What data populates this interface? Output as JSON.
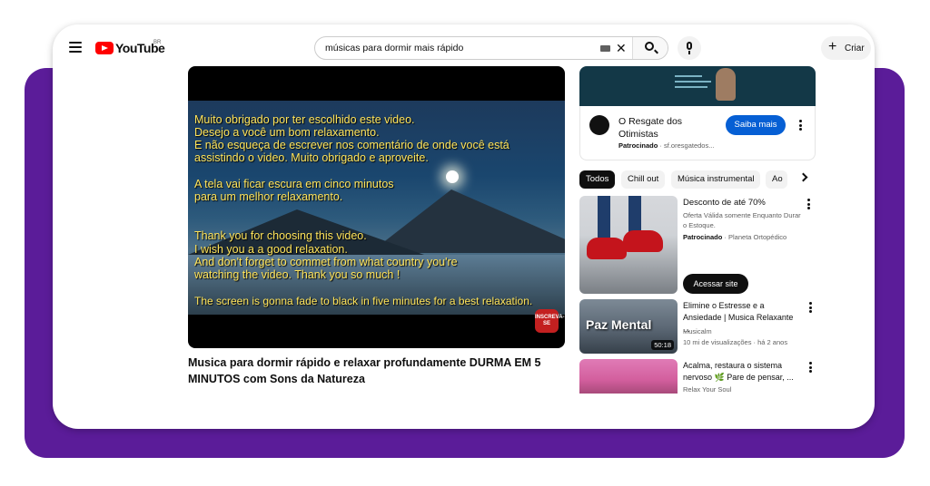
{
  "header": {
    "logo_text": "YouTube",
    "region": "BR",
    "search_value": "músicas para dormir mais rápido",
    "create_label": "Criar"
  },
  "player": {
    "lines_pt": [
      "Muito obrigado por ter escolhido este video.",
      "Desejo a você um bom relaxamento.",
      "E não esqueça de escrever nos comentário de onde você está",
      "assistindo o video. Muito obrigado e aproveite."
    ],
    "lines_pt2": [
      "A tela vai ficar escura em cinco minutos",
      "para um melhor relaxamento."
    ],
    "lines_en": [
      "Thank you for choosing this video.",
      "I wish you a a good relaxation.",
      "And don't forget to commet from what country you're",
      "watching the video. Thank you so much !"
    ],
    "line_fade": "The screen is gonna fade to black in five minutes for a best relaxation.",
    "subscribe_badge": "INSCREVA-SE"
  },
  "video": {
    "title": "Musica para dormir rápido e relaxar profundamente DURMA EM 5 MINUTOS com Sons da Natureza"
  },
  "ad": {
    "title": "O Resgate dos Otimistas",
    "sponsor_label": "Patrocinado",
    "sponsor_domain": "sf.oresgatedos...",
    "cta": "Saiba mais"
  },
  "chips": [
    "Todos",
    "Chill out",
    "Música instrumental",
    "Ao"
  ],
  "items": [
    {
      "title": "Desconto de até 70%",
      "desc": "Oferta Válida somente Enquanto Durar o Estoque.",
      "sponsor_label": "Patrocinado",
      "channel": "Planeta Ortopédico",
      "cta": "Acessar site"
    },
    {
      "title": "Elimine o Estresse e a Ansiedade | Musica Relaxante ...",
      "channel": "Musicalm",
      "stats": "10 mi de visualizações · há 2 anos",
      "thumb_text": "Paz Mental",
      "duration": "50:18"
    },
    {
      "title": "Acalma, restaura o sistema nervoso 🌿 Pare de pensar, ...",
      "channel": "Relax Your Soul"
    }
  ]
}
